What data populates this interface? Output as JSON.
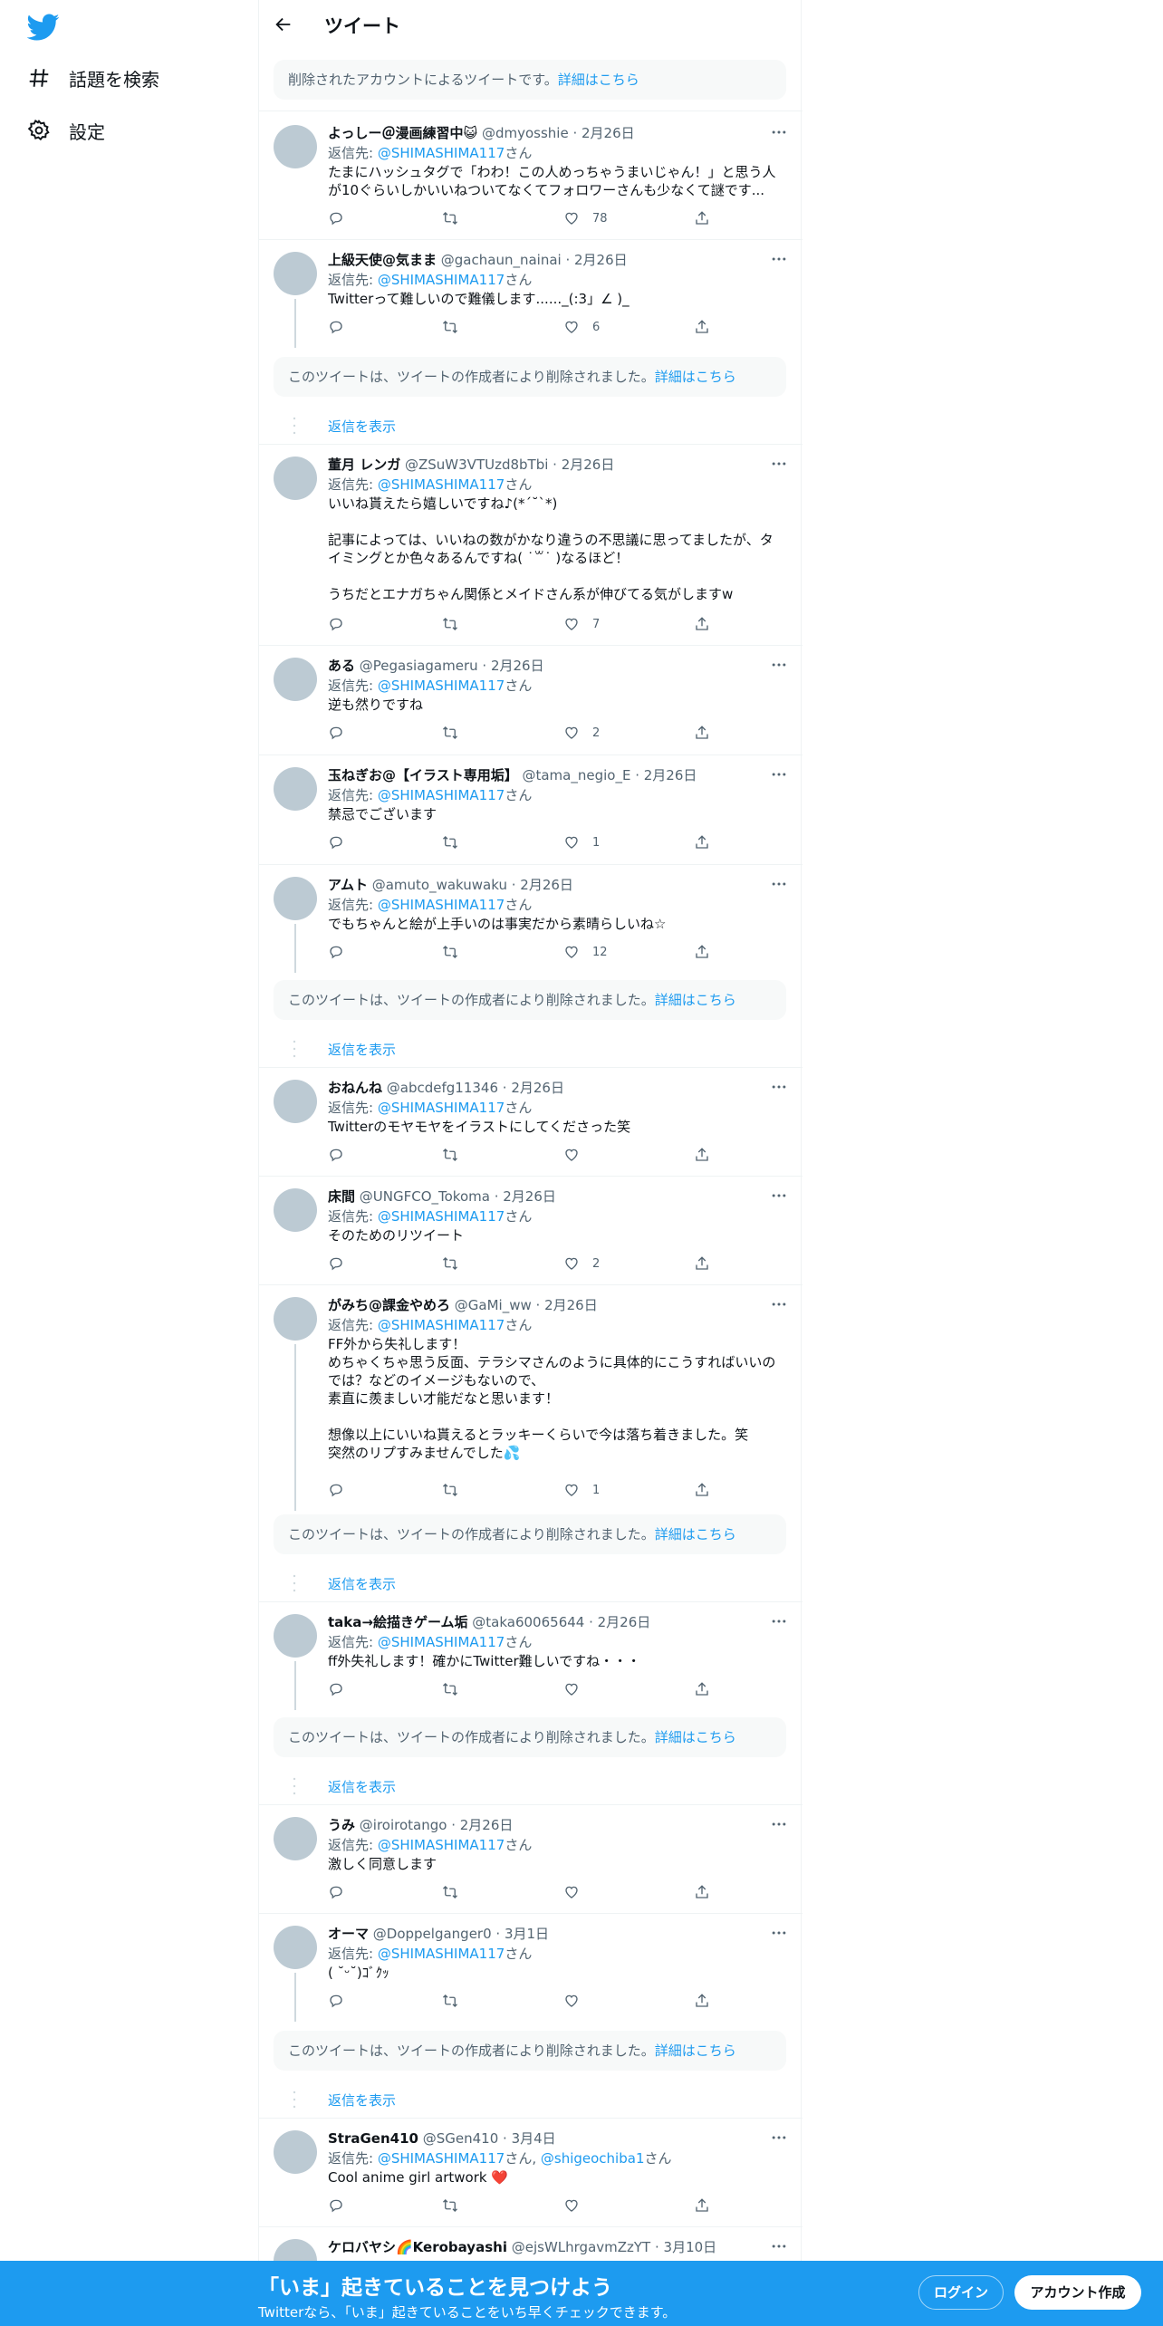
{
  "sidebar": {
    "explore_label": "話題を検索",
    "settings_label": "設定"
  },
  "header": {
    "title": "ツイート"
  },
  "notice": {
    "text": "削除されたアカウントによるツイートです。",
    "link": "詳細はこちら"
  },
  "deleted_notice": {
    "text": "このツイートは、ツイートの作成者により削除されました。",
    "link": "詳細はこちら"
  },
  "show_replies_label": "返信を表示",
  "reply_prefix": "返信先: ",
  "reply_suffix": "さん",
  "tweets": [
    {
      "name": "よっしー＠漫画練習中😺",
      "handle": "@dmyosshie",
      "date": "2月26日",
      "reply_to": "@SHIMASHIMA117",
      "text": "たまにハッシュタグで「わわ！この人めっちゃうまいじゃん！」と思う人\nが10ぐらいしかいいねついてなくてフォロワーさんも少なくて謎です...",
      "likes": "78"
    },
    {
      "name": "上級天使@気まま",
      "handle": "@gachaun_nainai",
      "date": "2月26日",
      "reply_to": "@SHIMASHIMA117",
      "text": "Twitterって難しいので難儀します......_(:3」∠ )_",
      "likes": "6"
    },
    {
      "name": "董月 レンガ",
      "handle": "@ZSuW3VTUzd8bTbi",
      "date": "2月26日",
      "reply_to": "@SHIMASHIMA117",
      "text": "いいね貰えたら嬉しいですね♪(*´˘`*)\n\n記事によっては、いいねの数がかなり違うの不思議に思ってましたが、タ\nイミングとか色々あるんですね( ˙꒳˙ )なるほど！\n\nうちだとエナガちゃん関係とメイドさん系が伸びてる気がしますw",
      "likes": "7"
    },
    {
      "name": "ある",
      "handle": "@Pegasiagameru",
      "date": "2月26日",
      "reply_to": "@SHIMASHIMA117",
      "text": "逆も然りですね",
      "likes": "2"
    },
    {
      "name": "玉ねぎお@【イラスト専用垢】",
      "handle": "@tama_negio_E",
      "date": "2月26日",
      "reply_to": "@SHIMASHIMA117",
      "text": "禁忌でございます",
      "likes": "1"
    },
    {
      "name": "アムト",
      "handle": "@amuto_wakuwaku",
      "date": "2月26日",
      "reply_to": "@SHIMASHIMA117",
      "text": "でもちゃんと絵が上手いのは事実だから素晴らしいね☆",
      "likes": "12"
    },
    {
      "name": "おねんね",
      "handle": "@abcdefg11346",
      "date": "2月26日",
      "reply_to": "@SHIMASHIMA117",
      "text": "Twitterのモヤモヤをイラストにしてくださった笑",
      "likes": ""
    },
    {
      "name": "床間",
      "handle": "@UNGFCO_Tokoma",
      "date": "2月26日",
      "reply_to": "@SHIMASHIMA117",
      "text": "そのためのリツイート",
      "likes": "2"
    },
    {
      "name": "がみち@課金やめろ",
      "handle": "@GaMi_ww",
      "date": "2月26日",
      "reply_to": "@SHIMASHIMA117",
      "text": "FF外から失礼します！\nめちゃくちゃ思う反面、テラシマさんのように具体的にこうすればいいの\nでは？などのイメージもないので、\n素直に羨ましい才能だなと思います！\n\n想像以上にいいね貰えるとラッキーくらいで今は落ち着きました。笑\n突然のリプすみませんでした💦",
      "likes": "1"
    },
    {
      "name": "taka→絵描きゲーム垢",
      "handle": "@taka60065644",
      "date": "2月26日",
      "reply_to": "@SHIMASHIMA117",
      "text": "ff外失礼します！確かにTwitter難しいですね・・・",
      "likes": ""
    },
    {
      "name": "うみ",
      "handle": "@iroirotango",
      "date": "2月26日",
      "reply_to": "@SHIMASHIMA117",
      "text": "激しく同意します",
      "likes": ""
    },
    {
      "name": "オーマ",
      "handle": "@Doppelganger0",
      "date": "3月1日",
      "reply_to": "@SHIMASHIMA117",
      "text": "( ˘ᵕ˘)ｺﾞｸｯ",
      "likes": ""
    },
    {
      "name": "StraGen410",
      "handle": "@SGen410",
      "date": "3月4日",
      "reply_to": "@SHIMASHIMA117",
      "reply_to_2": "@shigeochiba1",
      "text": "Cool anime girl artwork ❤️",
      "likes": ""
    },
    {
      "name": "ケロバヤシ🌈Kerobayashi",
      "handle": "@ejsWLhrgavmZzYT",
      "date": "3月10日",
      "reply_to": "",
      "text": "",
      "likes": ""
    }
  ],
  "bottom_bar": {
    "title": "「いま」起きていることを見つけよう",
    "subtitle": "Twitterなら、「いま」起きていることをいち早くチェックできます。",
    "login_label": "ログイン",
    "signup_label": "アカウント作成"
  },
  "colors": {
    "accent": "#1d9bf0",
    "text": "#0f1419",
    "muted": "#536471"
  }
}
